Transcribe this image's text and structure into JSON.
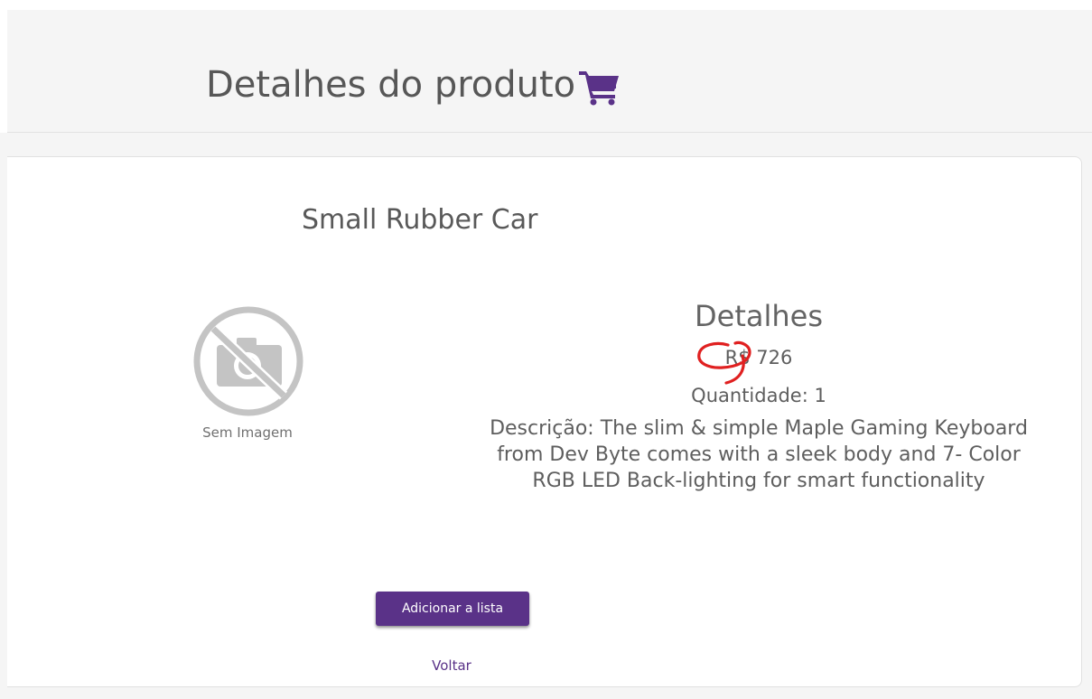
{
  "header": {
    "title": "Detalhes do produto",
    "icon": "shopping-cart-icon"
  },
  "product": {
    "name": "Small Rubber Car",
    "image_placeholder": {
      "icon": "no-camera-icon",
      "label": "Sem Imagem"
    },
    "details_heading": "Detalhes",
    "price": "R$ 726",
    "quantity": "Quantidade: 1",
    "description": "Descrição: The slim & simple Maple Gaming Keyboard from Dev Byte comes with a sleek body and 7- Color RGB LED Back-lighting for smart functionality"
  },
  "actions": {
    "add_label": "Adicionar a lista",
    "back_label": "Voltar"
  },
  "colors": {
    "accent": "#5a3288",
    "annotation": "#e02020"
  }
}
